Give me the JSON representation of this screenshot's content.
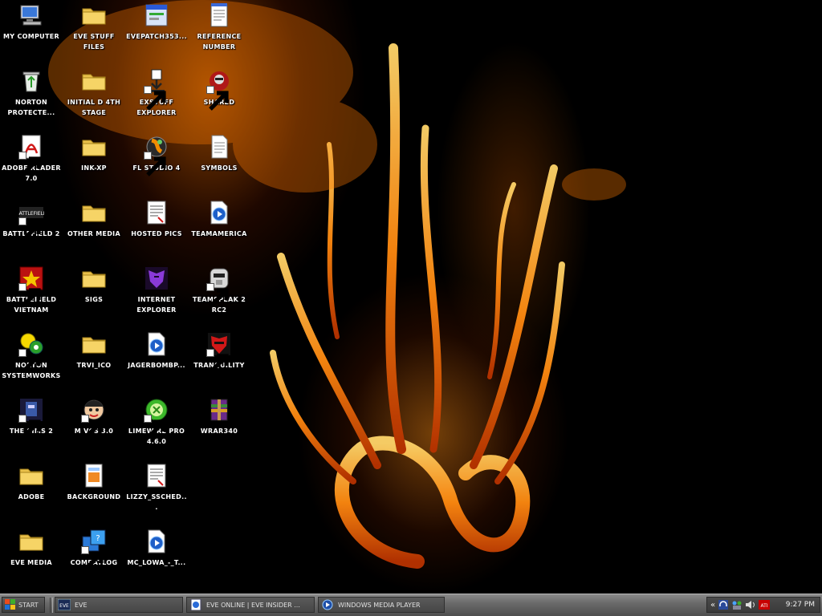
{
  "desktop": {
    "icons": [
      {
        "label": "My Computer",
        "icon": "my-computer-icon",
        "col": 0,
        "row": 0,
        "shortcut": false
      },
      {
        "label": "Norton Protecte...",
        "icon": "recycle-bin-icon",
        "col": 0,
        "row": 1,
        "shortcut": false
      },
      {
        "label": "Adobe Reader 7.0",
        "icon": "adobe-reader-icon",
        "col": 0,
        "row": 2,
        "shortcut": true
      },
      {
        "label": "Battlefield 2",
        "icon": "battlefield-2-icon",
        "col": 0,
        "row": 3,
        "shortcut": true
      },
      {
        "label": "Battlefield Vietnam",
        "icon": "battlefield-vietnam-icon",
        "col": 0,
        "row": 4,
        "shortcut": true
      },
      {
        "label": "Norton SystemWorks",
        "icon": "norton-systemworks-icon",
        "col": 0,
        "row": 5,
        "shortcut": true
      },
      {
        "label": "The Sims 2",
        "icon": "the-sims-2-icon",
        "col": 0,
        "row": 6,
        "shortcut": true
      },
      {
        "label": "Adobe",
        "icon": "folder-icon",
        "col": 0,
        "row": 7,
        "shortcut": false
      },
      {
        "label": "EVE Media",
        "icon": "folder-icon",
        "col": 0,
        "row": 8,
        "shortcut": false
      },
      {
        "label": "EVE Stuff Files",
        "icon": "folder-icon",
        "col": 1,
        "row": 0,
        "shortcut": false
      },
      {
        "label": "Initial D 4th Stage",
        "icon": "folder-icon",
        "col": 1,
        "row": 1,
        "shortcut": false
      },
      {
        "label": "ink-xp",
        "icon": "folder-icon",
        "col": 1,
        "row": 2,
        "shortcut": false
      },
      {
        "label": "Other Media",
        "icon": "folder-icon",
        "col": 1,
        "row": 3,
        "shortcut": false
      },
      {
        "label": "sigs",
        "icon": "folder-icon",
        "col": 1,
        "row": 4,
        "shortcut": false
      },
      {
        "label": "trvi_ico",
        "icon": "folder-icon",
        "col": 1,
        "row": 5,
        "shortcut": false
      },
      {
        "label": "m vcs 3.0",
        "icon": "cartoon-face-icon",
        "col": 1,
        "row": 6,
        "shortcut": true
      },
      {
        "label": "Background",
        "icon": "image-file-icon",
        "col": 1,
        "row": 7,
        "shortcut": false
      },
      {
        "label": "combatlog",
        "icon": "combatlog-icon",
        "col": 1,
        "row": 8,
        "shortcut": true
      },
      {
        "label": "evepatch353...",
        "icon": "installer-icon",
        "col": 2,
        "row": 0,
        "shortcut": false
      },
      {
        "label": "EXStuff Explorer",
        "icon": "download-icon",
        "col": 2,
        "row": 1,
        "shortcut": true
      },
      {
        "label": "FL Studio 4",
        "icon": "fl-studio-icon",
        "col": 2,
        "row": 2,
        "shortcut": true
      },
      {
        "label": "hosted pics",
        "icon": "document-icon",
        "col": 2,
        "row": 3,
        "shortcut": false
      },
      {
        "label": "Internet Explorer",
        "icon": "decepticon-icon",
        "col": 2,
        "row": 4,
        "shortcut": false
      },
      {
        "label": "jagerbombp...",
        "icon": "media-file-icon",
        "col": 2,
        "row": 5,
        "shortcut": false
      },
      {
        "label": "LimeWire PRO 4.6.0",
        "icon": "limewire-icon",
        "col": 2,
        "row": 6,
        "shortcut": true
      },
      {
        "label": "lizzy_ssched...",
        "icon": "document-icon",
        "col": 2,
        "row": 7,
        "shortcut": false
      },
      {
        "label": "MC_Lowa_-_T...",
        "icon": "media-file-icon",
        "col": 2,
        "row": 8,
        "shortcut": false
      },
      {
        "label": "reference number",
        "icon": "notepad-icon",
        "col": 3,
        "row": 0,
        "shortcut": false
      },
      {
        "label": "Shared",
        "icon": "shared-icon",
        "col": 3,
        "row": 1,
        "shortcut": true
      },
      {
        "label": "symbols",
        "icon": "text-file-icon",
        "col": 3,
        "row": 2,
        "shortcut": false
      },
      {
        "label": "teamamerica",
        "icon": "media-file-icon",
        "col": 3,
        "row": 3,
        "shortcut": false
      },
      {
        "label": "TeamSpeak 2 RC2",
        "icon": "teamspeak-icon",
        "col": 3,
        "row": 4,
        "shortcut": true
      },
      {
        "label": "Tranquility",
        "icon": "autobot-icon",
        "col": 3,
        "row": 5,
        "shortcut": true
      },
      {
        "label": "wrar340",
        "icon": "winrar-icon",
        "col": 3,
        "row": 6,
        "shortcut": false
      }
    ]
  },
  "taskbar": {
    "start_label": "Start",
    "tasks": [
      {
        "label": "EVE",
        "icon": "eve-icon"
      },
      {
        "label": "EVE Online | EVE Insider ...",
        "icon": "browser-page-icon"
      },
      {
        "label": "Windows Media Player",
        "icon": "media-player-icon"
      }
    ],
    "tray": {
      "chevron": "«",
      "icons": [
        "headset-icon",
        "network-icon",
        "volume-icon",
        "ati-icon"
      ],
      "clock": "9:27 PM"
    }
  }
}
